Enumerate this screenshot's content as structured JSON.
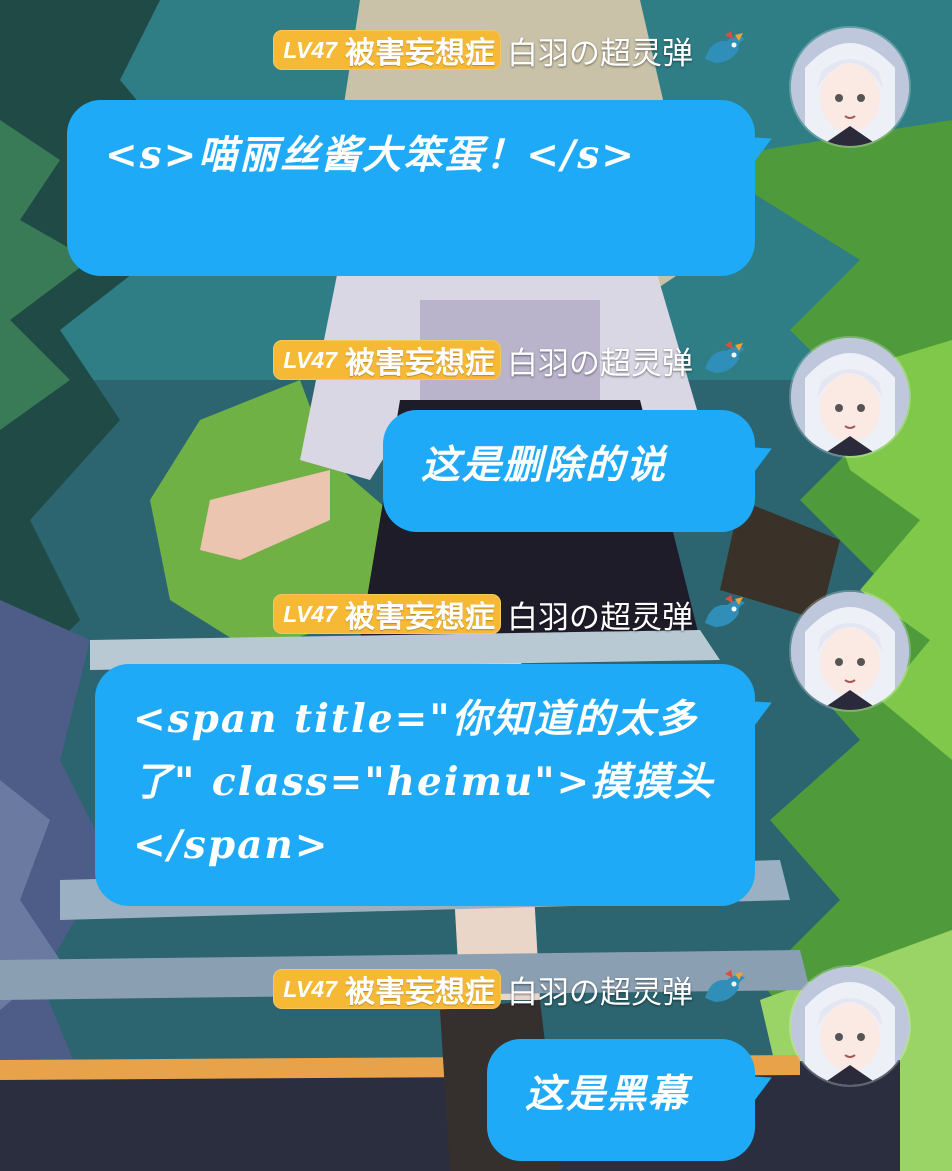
{
  "chat": {
    "messages": [
      {
        "level": "LV47",
        "medal": "被害妄想症",
        "username": "白羽の超灵弹",
        "text": "<s>喵丽丝酱大笨蛋！</s>"
      },
      {
        "level": "LV47",
        "medal": "被害妄想症",
        "username": "白羽の超灵弹",
        "text": "这是删除的说"
      },
      {
        "level": "LV47",
        "medal": "被害妄想症",
        "username": "白羽の超灵弹",
        "text": "<span title=\"你知道的太多了\" class=\"heimu\">摸摸头</span>"
      },
      {
        "level": "LV47",
        "medal": "被害妄想症",
        "username": "白羽の超灵弹",
        "text": "这是黑幕"
      }
    ]
  },
  "colors": {
    "bubble": "#1eaaf6",
    "level_badge": "#f5b935",
    "text": "#ffffff"
  },
  "icons": {
    "medal_decoration": "dragon-icon",
    "avatar": "avatar"
  }
}
